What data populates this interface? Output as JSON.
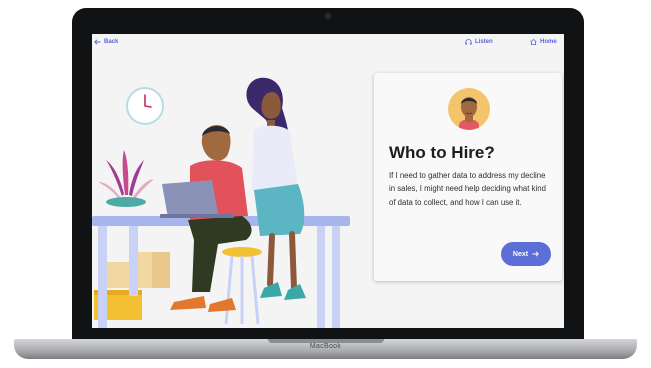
{
  "device": {
    "brand": "MacBook"
  },
  "nav": {
    "back_label": "Back",
    "listen_label": "Listen",
    "home_label": "Home"
  },
  "card": {
    "title": "Who to Hire?",
    "body": "If I need to gather data to address my decline in sales, I might need help deciding what kind of data to collect, and how I can use it.",
    "next_label": "Next"
  },
  "colors": {
    "accent": "#5c6fd6",
    "avatar_bg": "#f3c46a",
    "screen_bg": "#f4f4f5"
  },
  "icons": {
    "back": "arrow-left-icon",
    "listen": "headphones-icon",
    "home": "home-icon",
    "next": "arrow-right-icon"
  }
}
